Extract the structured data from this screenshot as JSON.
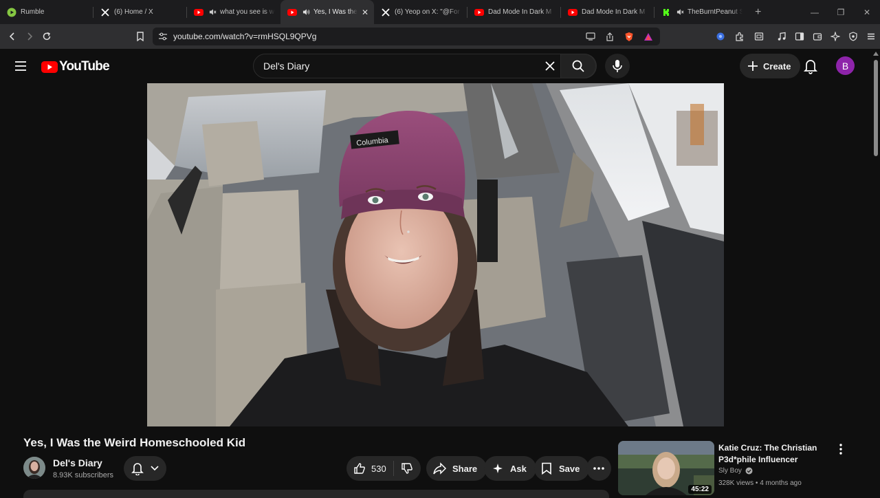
{
  "browser": {
    "tabs": [
      {
        "title": "Rumble",
        "icon": "rumble-icon"
      },
      {
        "title": "(6) Home / X",
        "icon": "x-icon"
      },
      {
        "title": "what you see is w",
        "icon": "youtube-icon"
      },
      {
        "title": "Yes, I Was the",
        "icon": "youtube-icon",
        "active": true
      },
      {
        "title": "(6) Yeop on X: \"@For",
        "icon": "x-icon"
      },
      {
        "title": "Dad Mode In Dark M",
        "icon": "youtube-icon"
      },
      {
        "title": "Dad Mode In Dark M",
        "icon": "youtube-icon"
      },
      {
        "title": "TheBurntPeanut S",
        "icon": "kick-icon"
      }
    ],
    "url": "youtube.com/watch?v=rmHSQL9QPVg"
  },
  "youtube": {
    "logo_text": "YouTube",
    "search_value": "Del's Diary",
    "create_label": "Create",
    "avatar_letter": "B"
  },
  "video": {
    "title": "Yes, I Was the Weird Homeschooled Kid",
    "channel": "Del's Diary",
    "subscribers": "8.93K subscribers",
    "likes": "530",
    "share_label": "Share",
    "ask_label": "Ask",
    "save_label": "Save",
    "hat_brand": "Columbia"
  },
  "recommended": [
    {
      "title": "Katie Cruz: The Christian P3d*phile Influencer",
      "channel": "Sly Boy",
      "meta": "328K views • 4 months ago",
      "duration": "45:22"
    }
  ],
  "colors": {
    "youtube_red": "#ff0000",
    "avatar_purple": "#8e24aa",
    "tab_bg": "#1c1c1e"
  }
}
